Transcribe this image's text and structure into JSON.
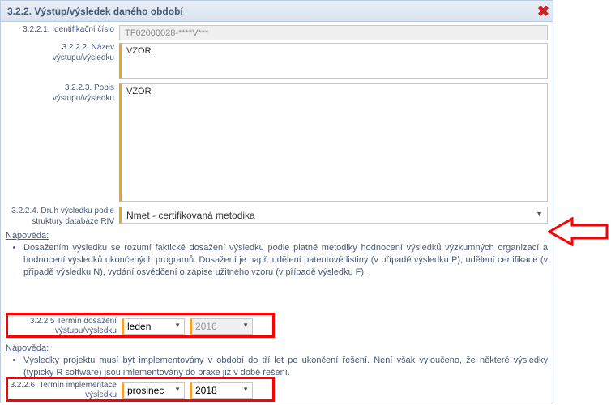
{
  "panel": {
    "title": "3.2.2. Výstup/výsledek daného období"
  },
  "fields": {
    "id_label": "3.2.2.1. Identifikační číslo",
    "id_value": "TF02000028-****V***",
    "name_label": "3.2.2.2. Název výstupu/výsledku",
    "name_value": "VZOR",
    "desc_label": "3.2.2.3. Popis výstupu/výsledku",
    "desc_value": "VZOR",
    "type_label": "3.2.2.4. Druh výsledku podle struktury databáze RIV",
    "type_value": "Nmet - certifikovaná metodika",
    "term1_label": "3.2.2.5 Termín dosažení výstupu/výsledku",
    "term1_month": "leden",
    "term1_year": "2016",
    "term2_label": "3.2.2.6. Termín implementace výsledku",
    "term2_month": "prosinec",
    "term2_year": "2018"
  },
  "help1": {
    "title": "Nápověda:",
    "bullet": "Dosažením výsledku se rozumí faktické dosažení výsledku podle platné metodiky hodnocení výsledků výzkumných organizací a hodnocení výsledků ukončených programů. Dosažení je např. udělení patentové listiny (v případě výsledku P), udělení certifikace (v případě výsledku N), vydání osvědčení o zápise užitného vzoru (v případě výsledku F)."
  },
  "help2": {
    "title": "Nápověda:",
    "bullet": "Výsledky projektu musí být implementovány v období do tří let po ukončení řešení. Není však vyloučeno, že některé výsledky (typicky R software) jsou imlementovány do praxe již v době řešení."
  }
}
